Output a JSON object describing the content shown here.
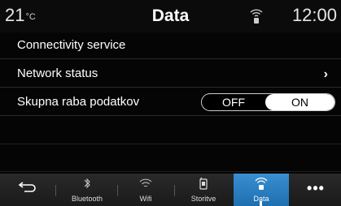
{
  "status": {
    "temperature": "21",
    "temp_unit": "°C",
    "title": "Data",
    "clock": "12:00"
  },
  "menu": [
    {
      "label": "Connectivity service"
    },
    {
      "label": "Network status"
    },
    {
      "label": "Skupna raba podatkov"
    }
  ],
  "toggle": {
    "off_label": "OFF",
    "on_label": "ON",
    "selected": "ON"
  },
  "tabs": [
    {
      "label": "",
      "icon": "back-icon"
    },
    {
      "label": "Bluetooth",
      "icon": "bluetooth-icon"
    },
    {
      "label": "Wifi",
      "icon": "wifi-icon"
    },
    {
      "label": "Storitve",
      "icon": "services-icon"
    },
    {
      "label": "Data",
      "icon": "data-signal-icon",
      "active": true
    },
    {
      "label": "",
      "icon": "more-icon"
    }
  ],
  "colors": {
    "accent": "#2a86c8",
    "background": "#050505"
  }
}
